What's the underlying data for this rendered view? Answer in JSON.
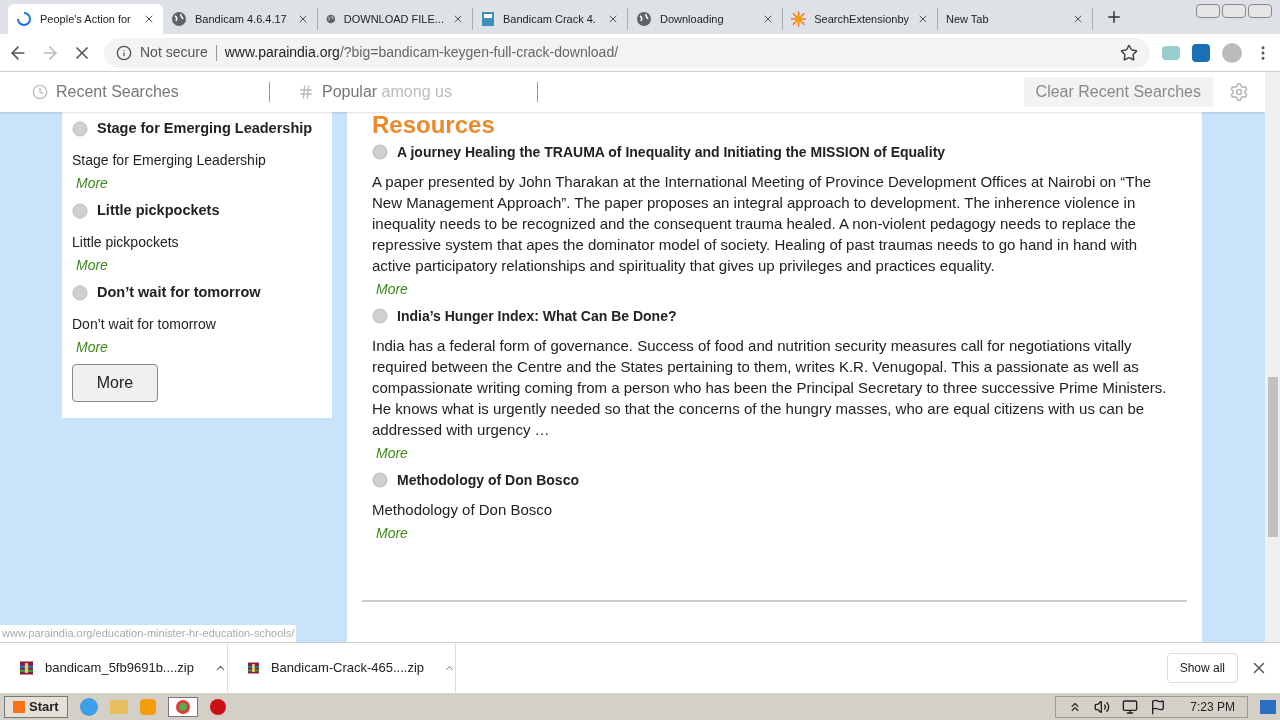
{
  "tabs": [
    {
      "title": "People's Action for",
      "kind": "loading",
      "selected": true
    },
    {
      "title": "Bandicam 4.6.4.17",
      "kind": "web",
      "selected": false
    },
    {
      "title": "DOWNLOAD FILE...",
      "kind": "web",
      "selected": false
    },
    {
      "title": "Bandicam Crack 4.",
      "kind": "book",
      "selected": false
    },
    {
      "title": "Downloading",
      "kind": "web",
      "selected": false
    },
    {
      "title": "SearchExtensionby",
      "kind": "sun",
      "selected": false
    },
    {
      "title": "New Tab",
      "kind": "blank",
      "selected": false
    }
  ],
  "address": {
    "security": "Not secure",
    "host": "www.paraindia.org",
    "path": "/?big=bandicam-keygen-full-crack-download/"
  },
  "search_bar": {
    "recent": "Recent Searches",
    "popular": "Popular",
    "popular_suffix": "among us",
    "clear": "Clear Recent Searches"
  },
  "sidebar": {
    "items": [
      {
        "title": "Stage for Emerging Leadership",
        "description": "Stage for Emerging Leadership",
        "more": "More"
      },
      {
        "title": "Little pickpockets",
        "description": "Little pickpockets",
        "more": "More"
      },
      {
        "title": "Don’t wait for tomorrow",
        "description": "Don’t wait for tomorrow",
        "more": "More"
      }
    ],
    "more_button": "More"
  },
  "resources": {
    "heading": "Resources",
    "items": [
      {
        "title": "A journey Healing the TRAUMA of Inequality and Initiating the MISSION of Equality",
        "description": "A paper presented by John Tharakan at the International Meeting of Province Development Offices at Nairobi on “The New Management Approach”. The paper proposes an integral approach to development. The inherence violence in inequality needs to be recognized and the consequent trauma healed. A non-violent pedagogy needs to replace the repressive system that apes the dominator model of society. Healing of past traumas needs to go hand in hand with active participatory relationships and spirituality that gives up privileges and practices equality.",
        "more": "More"
      },
      {
        "title": "India’s Hunger Index: What Can Be Done?",
        "description": "India has a federal form of governance. Success of food and nutrition security measures call for negotiations vitally required between the Centre and the States pertaining to them, writes K.R. Venugopal. This a passionate as well as compassionate writing coming from a person who has been the Principal Secretary to three successive Prime Ministers. He knows what is urgently needed so that the concerns of the hungry masses, who are equal citizens with us can be addressed with urgency …",
        "more": "More"
      },
      {
        "title": "Methodology of Don Bosco",
        "description": "Methodology of Don Bosco",
        "more": "More"
      }
    ]
  },
  "status_url": "www.paraindia.org/education-minister-hr-education-schools/",
  "downloads": {
    "items": [
      "bandicam_5fb9691b....zip",
      "Bandicam-Crack-465....zip"
    ],
    "show_all": "Show all"
  },
  "taskbar": {
    "start": "Start",
    "clock": "7:23 PM"
  }
}
